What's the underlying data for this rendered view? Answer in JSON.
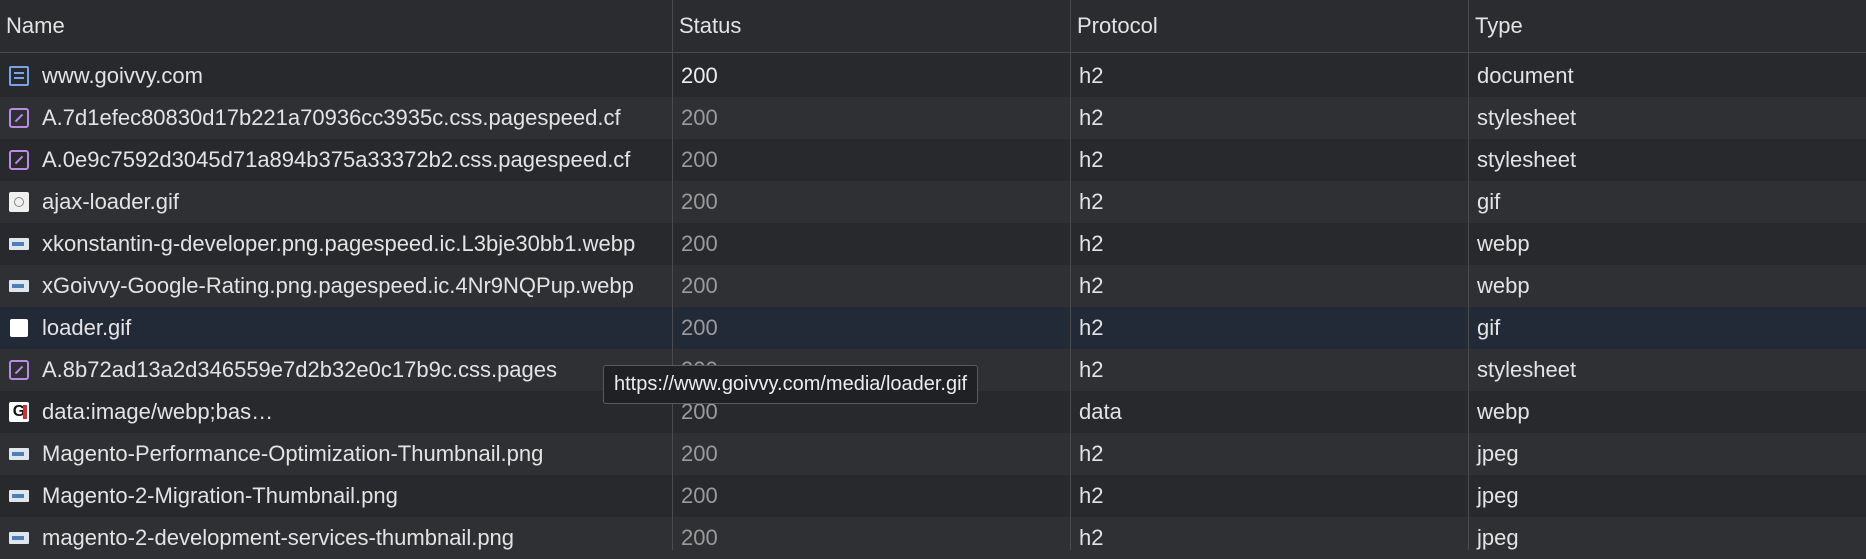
{
  "columns": {
    "name": "Name",
    "status": "Status",
    "protocol": "Protocol",
    "type": "Type"
  },
  "rows": [
    {
      "name": "www.goivvy.com",
      "status": "200",
      "protocol": "h2",
      "type": "document",
      "icon": "document-icon"
    },
    {
      "name": "A.7d1efec80830d17b221a70936cc3935c.css.pagespeed.cf",
      "status": "200",
      "protocol": "h2",
      "type": "stylesheet",
      "icon": "stylesheet-icon"
    },
    {
      "name": "A.0e9c7592d3045d71a894b375a33372b2.css.pagespeed.cf",
      "status": "200",
      "protocol": "h2",
      "type": "stylesheet",
      "icon": "stylesheet-icon"
    },
    {
      "name": "ajax-loader.gif",
      "status": "200",
      "protocol": "h2",
      "type": "gif",
      "icon": "gif-icon"
    },
    {
      "name": "xkonstantin-g-developer.png.pagespeed.ic.L3bje30bb1.webp",
      "status": "200",
      "protocol": "h2",
      "type": "webp",
      "icon": "image-thumbnail-icon"
    },
    {
      "name": "xGoivvy-Google-Rating.png.pagespeed.ic.4Nr9NQPup.webp",
      "status": "200",
      "protocol": "h2",
      "type": "webp",
      "icon": "image-thumbnail-icon"
    },
    {
      "name": "loader.gif",
      "status": "200",
      "protocol": "h2",
      "type": "gif",
      "icon": "gif-icon"
    },
    {
      "name": "A.8b72ad13a2d346559e7d2b32e0c17b9c.css.pages",
      "status": "200",
      "protocol": "h2",
      "type": "stylesheet",
      "icon": "stylesheet-icon"
    },
    {
      "name": "data:image/webp;bas…",
      "status": "200",
      "protocol": "data",
      "type": "webp",
      "icon": "google-icon"
    },
    {
      "name": "Magento-Performance-Optimization-Thumbnail.png",
      "status": "200",
      "protocol": "h2",
      "type": "jpeg",
      "icon": "image-thumbnail-icon"
    },
    {
      "name": "Magento-2-Migration-Thumbnail.png",
      "status": "200",
      "protocol": "h2",
      "type": "jpeg",
      "icon": "image-thumbnail-icon"
    },
    {
      "name": "magento-2-development-services-thumbnail.png",
      "status": "200",
      "protocol": "h2",
      "type": "jpeg",
      "icon": "image-thumbnail-icon"
    }
  ],
  "tooltip": "https://www.goivvy.com/media/loader.gif",
  "colors": {
    "background": "#28292c",
    "row_alt": "#2f3033",
    "row_selected": "#232a37",
    "text": "#e3e3e3",
    "status_dim": "#9a9a9a"
  }
}
